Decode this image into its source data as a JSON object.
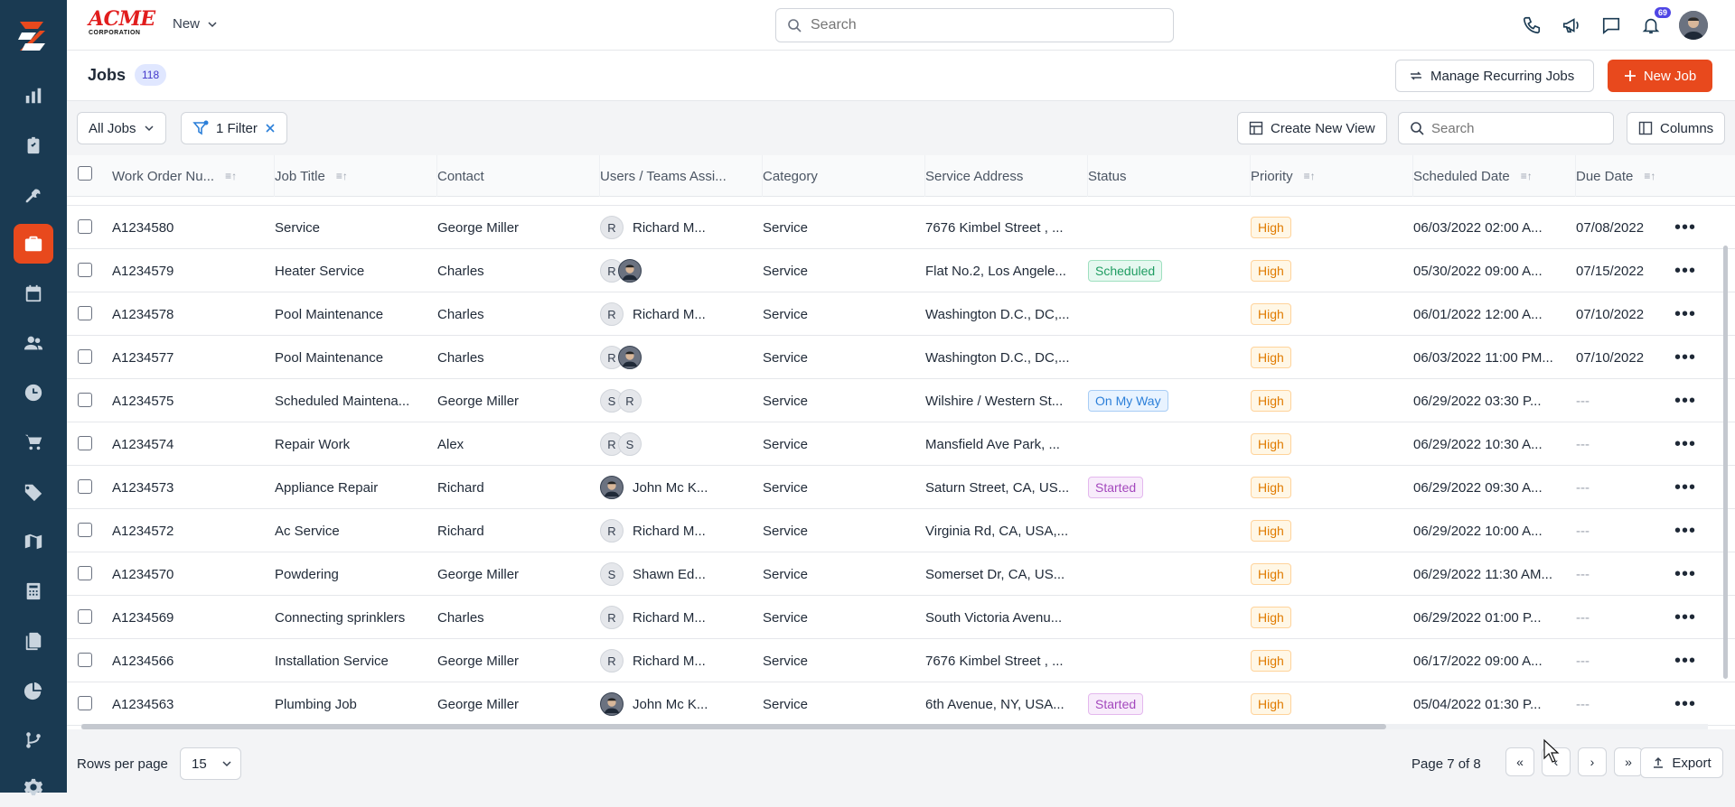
{
  "topbar": {
    "brand": "ACME",
    "brand_sub": "CORPORATION",
    "new_label": "New",
    "search_placeholder": "Search",
    "notification_count": "69"
  },
  "page": {
    "title": "Jobs",
    "count": "118",
    "manage_recurring_label": "Manage Recurring Jobs",
    "new_job_label": "New Job"
  },
  "filters": {
    "view_label": "All Jobs",
    "filter_label": "1 Filter",
    "create_view_label": "Create New View",
    "search_placeholder": "Search",
    "columns_label": "Columns"
  },
  "columns": [
    "Work Order Nu...",
    "Job Title",
    "Contact",
    "Users / Teams Assi...",
    "Category",
    "Service Address",
    "Status",
    "Priority",
    "Scheduled Date",
    "Due Date"
  ],
  "rows": [
    {
      "wo": "A1234580",
      "title": "Service",
      "contact": "George Miller",
      "users": [
        {
          "initial": "R",
          "photo": false
        }
      ],
      "user_name": "Richard M...",
      "category": "Service",
      "address": "7676 Kimbel Street , ...",
      "status": "",
      "priority": "High",
      "scheduled": "06/03/2022 02:00 A...",
      "due": "07/08/2022"
    },
    {
      "wo": "A1234579",
      "title": "Heater Service",
      "contact": "Charles",
      "users": [
        {
          "initial": "R",
          "photo": false
        },
        {
          "initial": "",
          "photo": true
        }
      ],
      "user_name": "",
      "category": "Service",
      "address": "Flat No.2, Los Angele...",
      "status": "Scheduled",
      "priority": "High",
      "scheduled": "05/30/2022 09:00 A...",
      "due": "07/15/2022"
    },
    {
      "wo": "A1234578",
      "title": "Pool Maintenance",
      "contact": "Charles",
      "users": [
        {
          "initial": "R",
          "photo": false
        }
      ],
      "user_name": "Richard M...",
      "category": "Service",
      "address": "Washington D.C., DC,...",
      "status": "",
      "priority": "High",
      "scheduled": "06/01/2022 12:00 A...",
      "due": "07/10/2022"
    },
    {
      "wo": "A1234577",
      "title": "Pool Maintenance",
      "contact": "Charles",
      "users": [
        {
          "initial": "R",
          "photo": false
        },
        {
          "initial": "",
          "photo": true
        }
      ],
      "user_name": "",
      "category": "Service",
      "address": "Washington D.C., DC,...",
      "status": "",
      "priority": "High",
      "scheduled": "06/03/2022 11:00 PM...",
      "due": "07/10/2022"
    },
    {
      "wo": "A1234575",
      "title": "Scheduled Maintena...",
      "contact": "George Miller",
      "users": [
        {
          "initial": "S",
          "photo": false
        },
        {
          "initial": "R",
          "photo": false
        }
      ],
      "user_name": "",
      "category": "Service",
      "address": "Wilshire / Western St...",
      "status": "On My Way",
      "priority": "High",
      "scheduled": "06/29/2022 03:30 P...",
      "due": "---"
    },
    {
      "wo": "A1234574",
      "title": "Repair Work",
      "contact": "Alex",
      "users": [
        {
          "initial": "R",
          "photo": false
        },
        {
          "initial": "S",
          "photo": false
        }
      ],
      "user_name": "",
      "category": "Service",
      "address": "Mansfield Ave Park, ...",
      "status": "",
      "priority": "High",
      "scheduled": "06/29/2022 10:30 A...",
      "due": "---"
    },
    {
      "wo": "A1234573",
      "title": "Appliance Repair",
      "contact": "Richard",
      "users": [
        {
          "initial": "",
          "photo": true
        }
      ],
      "user_name": "John Mc K...",
      "category": "Service",
      "address": "Saturn Street, CA, US...",
      "status": "Started",
      "priority": "High",
      "scheduled": "06/29/2022 09:30 A...",
      "due": "---"
    },
    {
      "wo": "A1234572",
      "title": "Ac Service",
      "contact": "Richard",
      "users": [
        {
          "initial": "R",
          "photo": false
        }
      ],
      "user_name": "Richard M...",
      "category": "Service",
      "address": "Virginia Rd, CA, USA,...",
      "status": "",
      "priority": "High",
      "scheduled": "06/29/2022 10:00 A...",
      "due": "---"
    },
    {
      "wo": "A1234570",
      "title": "Powdering",
      "contact": "George Miller",
      "users": [
        {
          "initial": "S",
          "photo": false
        }
      ],
      "user_name": "Shawn Ed...",
      "category": "Service",
      "address": "Somerset Dr, CA, US...",
      "status": "",
      "priority": "High",
      "scheduled": "06/29/2022 11:30 AM...",
      "due": "---"
    },
    {
      "wo": "A1234569",
      "title": "Connecting sprinklers",
      "contact": "Charles",
      "users": [
        {
          "initial": "R",
          "photo": false
        }
      ],
      "user_name": "Richard M...",
      "category": "Service",
      "address": "South Victoria Avenu...",
      "status": "",
      "priority": "High",
      "scheduled": "06/29/2022 01:00 P...",
      "due": "---"
    },
    {
      "wo": "A1234566",
      "title": "Installation Service",
      "contact": "George Miller",
      "users": [
        {
          "initial": "R",
          "photo": false
        }
      ],
      "user_name": "Richard M...",
      "category": "Service",
      "address": "7676 Kimbel Street , ...",
      "status": "",
      "priority": "High",
      "scheduled": "06/17/2022 09:00 A...",
      "due": "---"
    },
    {
      "wo": "A1234563",
      "title": "Plumbing Job",
      "contact": "George Miller",
      "users": [
        {
          "initial": "",
          "photo": true
        }
      ],
      "user_name": "John Mc K...",
      "category": "Service",
      "address": "6th Avenue, NY, USA...",
      "status": "Started",
      "priority": "High",
      "scheduled": "05/04/2022 01:30 P...",
      "due": "---"
    }
  ],
  "footer": {
    "rows_per_page_label": "Rows per page",
    "rows_per_page_value": "15",
    "page_info": "Page 7 of 8",
    "export_label": "Export"
  },
  "colors": {
    "sidebar": "#1a3a52",
    "accent": "#e8491d"
  },
  "sidebar_icons": [
    "logo-icon",
    "chart-icon",
    "clipboard-icon",
    "tools-icon",
    "briefcase-icon",
    "calendar-icon",
    "users-icon",
    "clock-icon",
    "cart-icon",
    "tag-icon",
    "map-icon",
    "calculator-icon",
    "documents-icon",
    "pie-chart-icon",
    "flow-icon",
    "gear-icon"
  ]
}
